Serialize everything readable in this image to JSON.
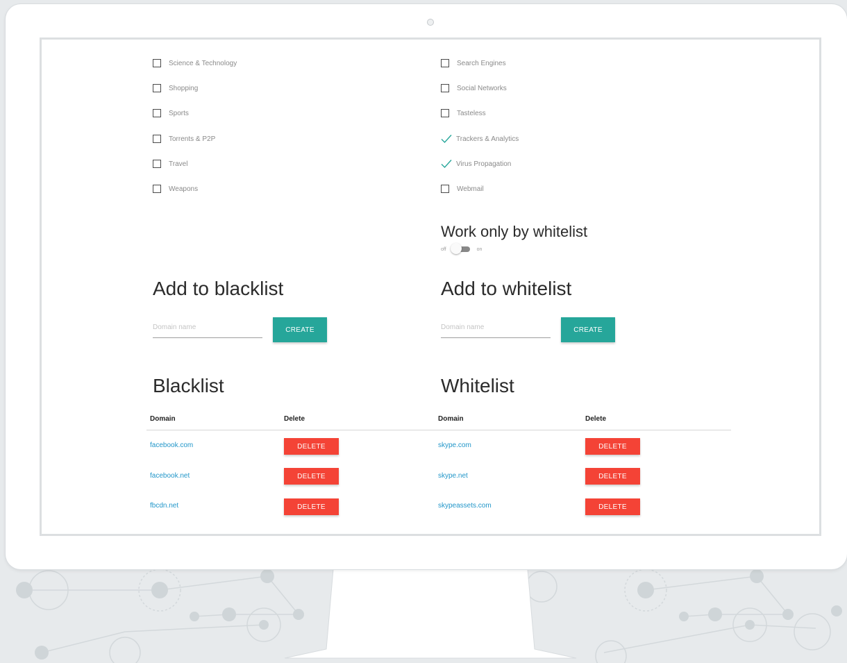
{
  "categories_left": [
    {
      "label": "Science & Technology",
      "checked": false
    },
    {
      "label": "Shopping",
      "checked": false
    },
    {
      "label": "Sports",
      "checked": false
    },
    {
      "label": "Torrents & P2P",
      "checked": false
    },
    {
      "label": "Travel",
      "checked": false
    },
    {
      "label": "Weapons",
      "checked": false
    }
  ],
  "categories_right": [
    {
      "label": "Search Engines",
      "checked": false
    },
    {
      "label": "Social Networks",
      "checked": false
    },
    {
      "label": "Tasteless",
      "checked": false
    },
    {
      "label": "Trackers & Analytics",
      "checked": true
    },
    {
      "label": "Virus Propagation",
      "checked": true
    },
    {
      "label": "Webmail",
      "checked": false
    }
  ],
  "whitelist_mode": {
    "title": "Work only by whitelist",
    "off_label": "off",
    "on_label": "on",
    "enabled": false
  },
  "add_blacklist": {
    "title": "Add to blacklist",
    "placeholder": "Domain name",
    "button": "CREATE"
  },
  "add_whitelist": {
    "title": "Add to whitelist",
    "placeholder": "Domain name",
    "button": "CREATE"
  },
  "blacklist": {
    "title": "Blacklist",
    "col_domain": "Domain",
    "col_delete": "Delete",
    "rows": [
      {
        "domain": "facebook.com",
        "action": "DELETE"
      },
      {
        "domain": "facebook.net",
        "action": "DELETE"
      },
      {
        "domain": "fbcdn.net",
        "action": "DELETE"
      }
    ]
  },
  "whitelist": {
    "title": "Whitelist",
    "col_domain": "Domain",
    "col_delete": "Delete",
    "rows": [
      {
        "domain": "skype.com",
        "action": "DELETE"
      },
      {
        "domain": "skype.net",
        "action": "DELETE"
      },
      {
        "domain": "skypeassets.com",
        "action": "DELETE"
      }
    ]
  },
  "colors": {
    "accent": "#26a69a",
    "danger": "#f44336",
    "link": "#2196c9"
  }
}
